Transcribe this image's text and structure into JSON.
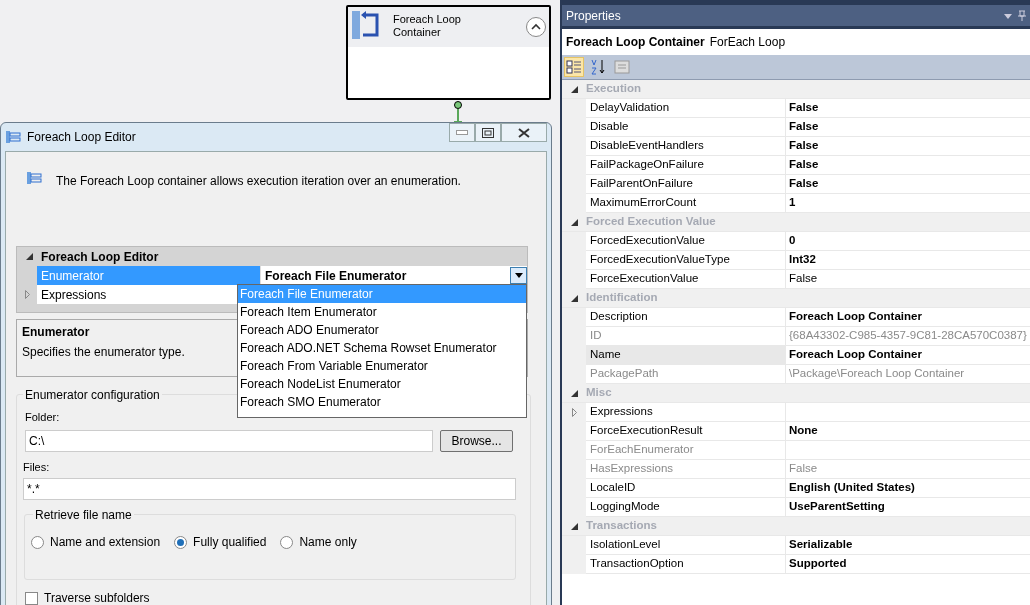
{
  "canvas": {
    "node": {
      "title": "Foreach Loop Container",
      "expanded": true
    }
  },
  "dialog": {
    "title": "Foreach Loop Editor",
    "description": "The Foreach Loop container allows execution iteration over an enumeration.",
    "grid": {
      "category": "Foreach Loop Editor",
      "rows": [
        {
          "name": "Enumerator",
          "value": "Foreach File Enumerator",
          "selected": true,
          "expandable": false
        },
        {
          "name": "Expressions",
          "selected": false,
          "expandable": true
        }
      ]
    },
    "dropdown": {
      "items": [
        {
          "label": "Foreach File Enumerator",
          "selected": true
        },
        {
          "label": "Foreach Item Enumerator",
          "selected": false
        },
        {
          "label": "Foreach ADO Enumerator",
          "selected": false
        },
        {
          "label": "Foreach ADO.NET Schema Rowset Enumerator",
          "selected": false
        },
        {
          "label": "Foreach From Variable Enumerator",
          "selected": false
        },
        {
          "label": "Foreach NodeList Enumerator",
          "selected": false
        },
        {
          "label": "Foreach SMO Enumerator",
          "selected": false
        }
      ]
    },
    "help": {
      "title": "Enumerator",
      "text": "Specifies the enumerator type."
    },
    "config": {
      "title": "Enumerator configuration",
      "folder_label": "Folder:",
      "folder_value": "C:\\",
      "browse": "Browse...",
      "files_label": "Files:",
      "files_value": "*.*",
      "retrieve": {
        "title": "Retrieve file name",
        "options": [
          {
            "label": "Name and extension",
            "selected": false
          },
          {
            "label": "Fully qualified",
            "selected": true
          },
          {
            "label": "Name only",
            "selected": false
          }
        ]
      },
      "traverse": {
        "label": "Traverse subfolders",
        "checked": false
      }
    }
  },
  "properties": {
    "title": "Properties",
    "object_name": "Foreach Loop Container",
    "object_type": "ForEach Loop",
    "toolbar": [
      {
        "kind": "categorized",
        "selected": true
      },
      {
        "kind": "alphabetical",
        "selected": false
      },
      {
        "kind": "pages",
        "selected": false
      }
    ],
    "categories": [
      {
        "name": "Execution",
        "rows": [
          {
            "name": "DelayValidation",
            "value": "False",
            "modified": true,
            "readonly": false,
            "selected": false
          },
          {
            "name": "Disable",
            "value": "False",
            "modified": true,
            "readonly": false,
            "selected": false
          },
          {
            "name": "DisableEventHandlers",
            "value": "False",
            "modified": true,
            "readonly": false,
            "selected": false
          },
          {
            "name": "FailPackageOnFailure",
            "value": "False",
            "modified": true,
            "readonly": false,
            "selected": false
          },
          {
            "name": "FailParentOnFailure",
            "value": "False",
            "modified": true,
            "readonly": false,
            "selected": false
          },
          {
            "name": "MaximumErrorCount",
            "value": "1",
            "modified": true,
            "readonly": false,
            "selected": false
          }
        ]
      },
      {
        "name": "Forced Execution Value",
        "rows": [
          {
            "name": "ForcedExecutionValue",
            "value": "0",
            "modified": true,
            "readonly": false,
            "selected": false
          },
          {
            "name": "ForcedExecutionValueType",
            "value": "Int32",
            "modified": true,
            "readonly": false,
            "selected": false
          },
          {
            "name": "ForceExecutionValue",
            "value": "False",
            "modified": false,
            "readonly": false,
            "selected": false
          }
        ]
      },
      {
        "name": "Identification",
        "rows": [
          {
            "name": "Description",
            "value": "Foreach Loop Container",
            "modified": true,
            "readonly": false,
            "selected": false
          },
          {
            "name": "ID",
            "value": "{68A43302-C985-4357-9C81-28CA570C0387}",
            "modified": false,
            "readonly": true,
            "selected": false
          },
          {
            "name": "Name",
            "value": "Foreach Loop Container",
            "modified": true,
            "readonly": false,
            "selected": true
          },
          {
            "name": "PackagePath",
            "value": "\\Package\\Foreach Loop Container",
            "modified": false,
            "readonly": true,
            "selected": false
          }
        ]
      },
      {
        "name": "Misc",
        "rows": [
          {
            "name": "Expressions",
            "readonly": false,
            "selected": false,
            "expandable": true
          },
          {
            "name": "ForceExecutionResult",
            "value": "None",
            "modified": true,
            "readonly": false,
            "selected": false
          },
          {
            "name": "ForEachEnumerator",
            "readonly": true,
            "selected": false
          },
          {
            "name": "HasExpressions",
            "value": "False",
            "modified": false,
            "readonly": true,
            "selected": false
          },
          {
            "name": "LocaleID",
            "value": "English (United States)",
            "modified": true,
            "readonly": false,
            "selected": false
          },
          {
            "name": "LoggingMode",
            "value": "UseParentSetting",
            "modified": true,
            "readonly": false,
            "selected": false
          }
        ]
      },
      {
        "name": "Transactions",
        "rows": [
          {
            "name": "IsolationLevel",
            "value": "Serializable",
            "modified": true,
            "readonly": false,
            "selected": false
          },
          {
            "name": "TransactionOption",
            "value": "Supported",
            "modified": true,
            "readonly": false,
            "selected": false
          }
        ]
      }
    ]
  }
}
